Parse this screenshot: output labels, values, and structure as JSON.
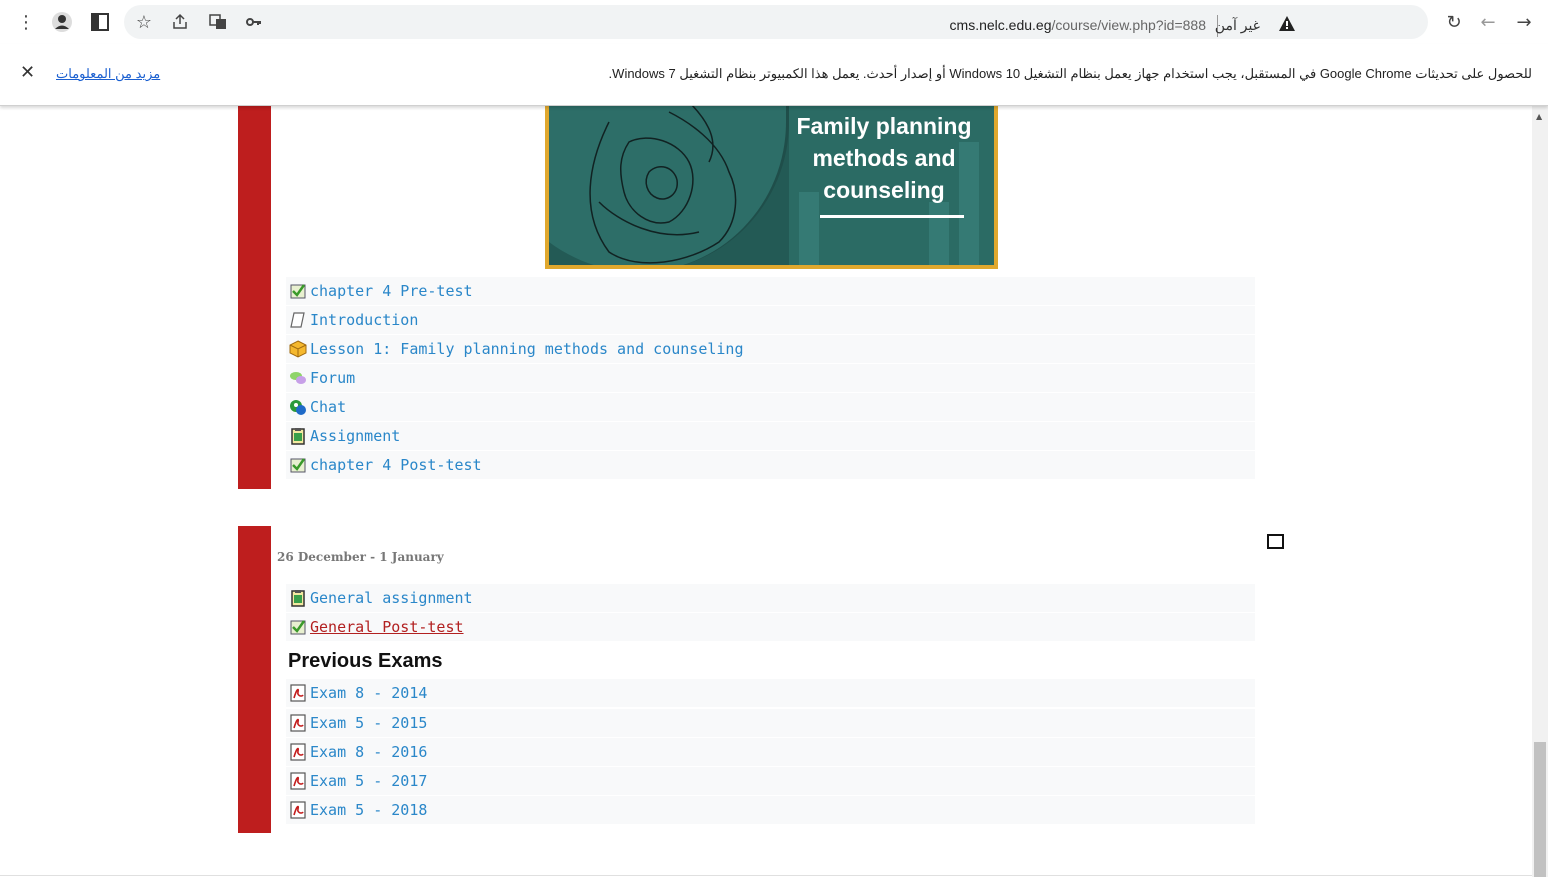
{
  "browser": {
    "url_host": "cms.nelc.edu.eg",
    "url_path": "/course/view.php?id=888",
    "security_label": "غير آمن",
    "icons": [
      "forward-icon",
      "back-icon",
      "reload-icon",
      "warning-icon",
      "key-icon",
      "translate-icon",
      "share-icon",
      "star-icon",
      "sidebar-icon",
      "profile-icon",
      "menu-icon"
    ]
  },
  "infobar": {
    "message": "للحصول على تحديثات Google Chrome في المستقبل، يجب استخدام جهاز يعمل بنظام التشغيل Windows 10 أو إصدار أحدث. يعمل هذا الكمبيوتر بنظام التشغيل Windows 7.",
    "link": "مزيد من المعلومات",
    "close": "✕"
  },
  "banner": {
    "line1": "Family planning",
    "line2": "methods and",
    "line3": "counseling"
  },
  "section1": {
    "activities": [
      {
        "label": "chapter 4 Pre-test",
        "icon": "quiz-icon"
      },
      {
        "label": "Introduction",
        "icon": "page-icon"
      },
      {
        "label": "Lesson 1: Family planning methods and counseling",
        "icon": "package-icon"
      },
      {
        "label": "Forum",
        "icon": "forum-icon"
      },
      {
        "label": "Chat",
        "icon": "chat-icon"
      },
      {
        "label": "Assignment",
        "icon": "assignment-icon"
      },
      {
        "label": "chapter 4 Post-test",
        "icon": "quiz-icon"
      }
    ]
  },
  "section2": {
    "date": "26 December - 1 January",
    "activities": [
      {
        "label": "General assignment",
        "icon": "assignment-icon"
      },
      {
        "label": "General Post-test",
        "icon": "quiz-icon"
      }
    ],
    "heading": "Previous Exams",
    "exams": [
      {
        "label": "Exam 8 - 2014",
        "icon": "pdf-icon"
      },
      {
        "label": "Exam 5 - 2015",
        "icon": "pdf-icon"
      },
      {
        "label": "Exam 8 - 2016",
        "icon": "pdf-icon"
      },
      {
        "label": "Exam 5 - 2017",
        "icon": "pdf-icon"
      },
      {
        "label": "Exam 5 - 2018",
        "icon": "pdf-icon"
      }
    ]
  },
  "colors": {
    "accent_red": "#be1e1e",
    "link_blue": "#2a87c9",
    "visited_red": "#b22020",
    "banner_teal": "#2b6b64",
    "banner_border": "#e0a82e"
  }
}
